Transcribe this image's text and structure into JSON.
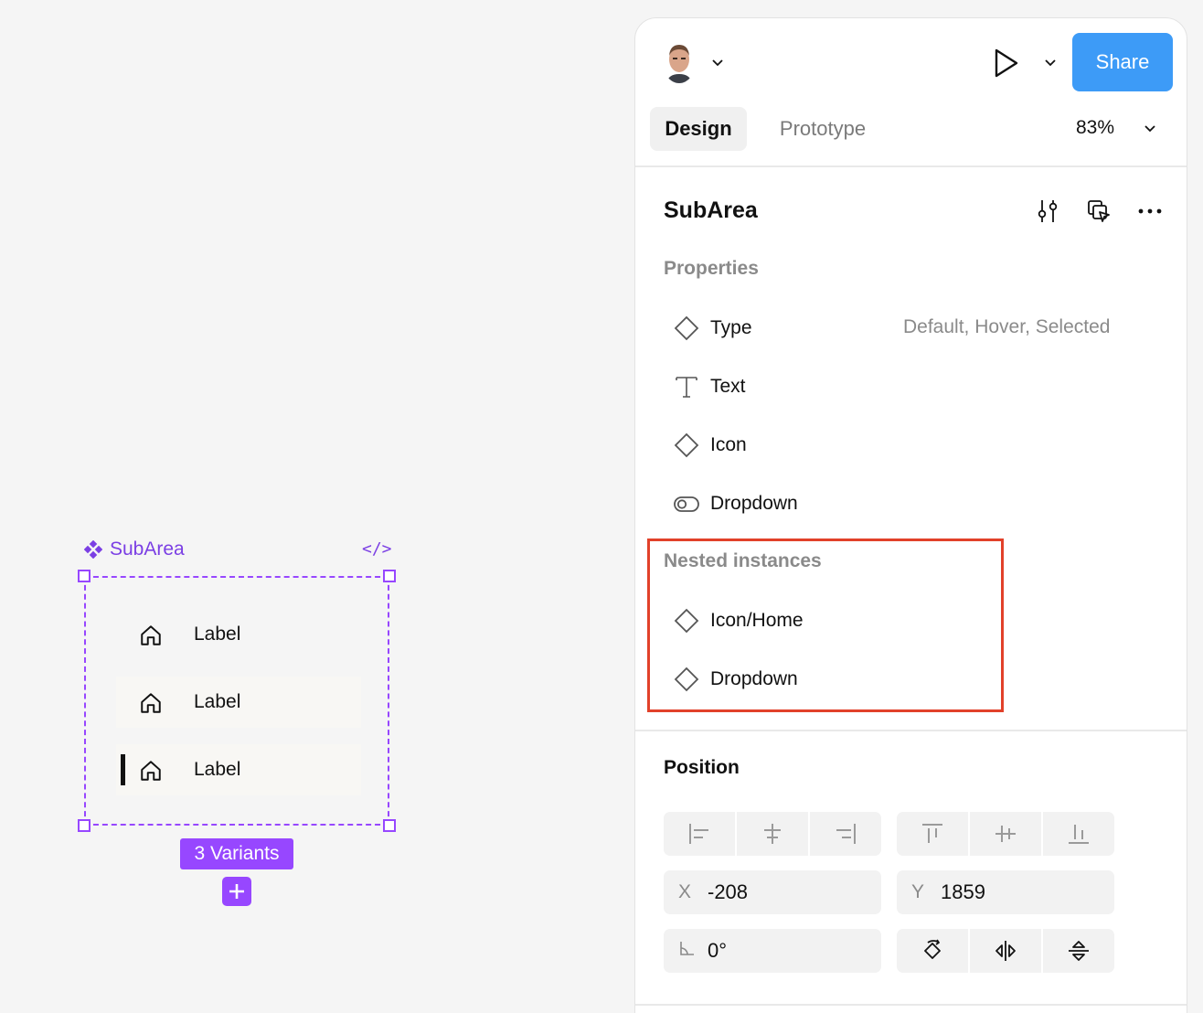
{
  "canvas": {
    "component_title": "SubArea",
    "code_icon": "code-icon",
    "variants": [
      {
        "label": "Label",
        "state": "default"
      },
      {
        "label": "Label",
        "state": "hover"
      },
      {
        "label": "Label",
        "state": "selected"
      }
    ],
    "variants_badge": "3 Variants",
    "accent_color": "#9747ff"
  },
  "header": {
    "share_label": "Share",
    "tabs": [
      {
        "label": "Design",
        "active": true
      },
      {
        "label": "Prototype",
        "active": false
      }
    ],
    "zoom": "83%",
    "share_color": "#3d9bf7"
  },
  "component": {
    "name": "SubArea"
  },
  "properties": {
    "title": "Properties",
    "items": [
      {
        "icon": "variant-diamond-icon",
        "label": "Type",
        "value": "Default, Hover, Selected"
      },
      {
        "icon": "text-icon",
        "label": "Text"
      },
      {
        "icon": "instance-swap-icon",
        "label": "Icon"
      },
      {
        "icon": "boolean-toggle-icon",
        "label": "Dropdown"
      }
    ]
  },
  "nested_instances": {
    "title": "Nested instances",
    "items": [
      {
        "icon": "instance-diamond-icon",
        "label": "Icon/Home"
      },
      {
        "icon": "instance-diamond-icon",
        "label": "Dropdown"
      }
    ],
    "highlight_color": "#e2412a"
  },
  "position": {
    "title": "Position",
    "x_label": "X",
    "x_value": "-208",
    "y_label": "Y",
    "y_value": "1859",
    "rotation_value": "0°"
  }
}
